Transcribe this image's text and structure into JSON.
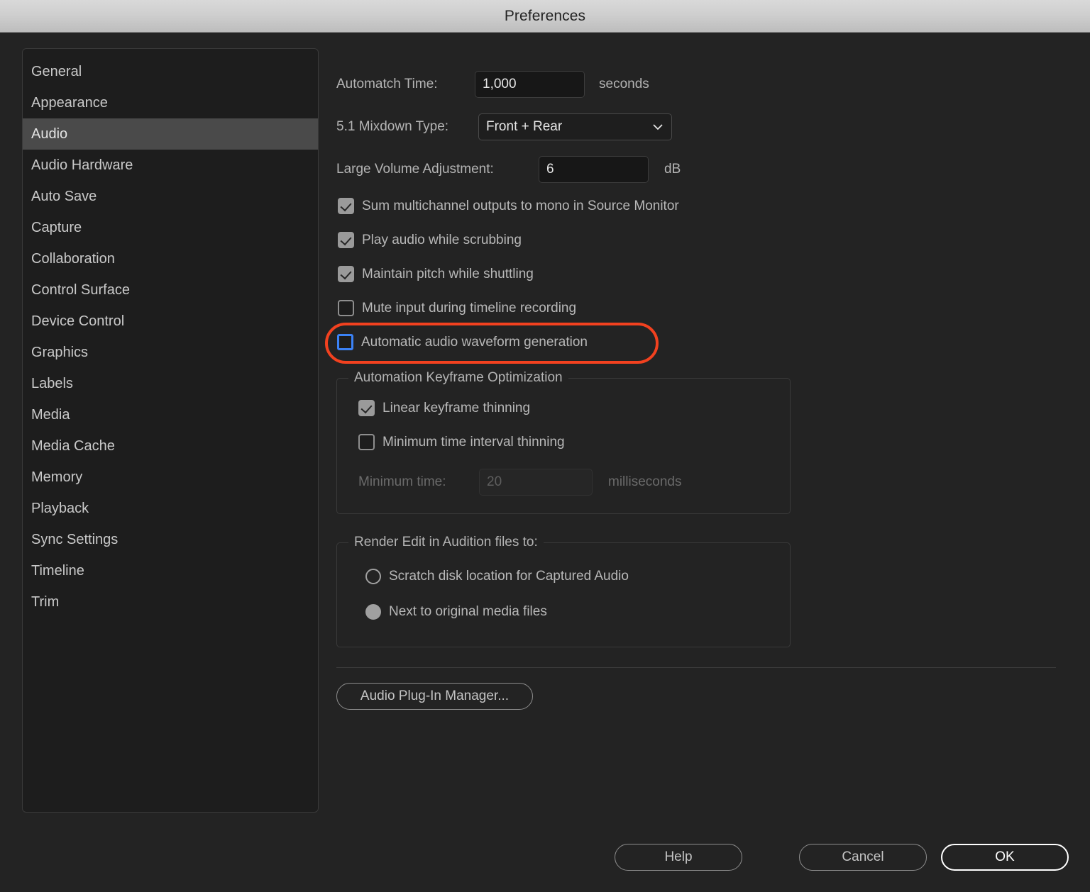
{
  "window": {
    "title": "Preferences"
  },
  "sidebar": {
    "items": [
      {
        "label": "General",
        "selected": false
      },
      {
        "label": "Appearance",
        "selected": false
      },
      {
        "label": "Audio",
        "selected": true
      },
      {
        "label": "Audio Hardware",
        "selected": false
      },
      {
        "label": "Auto Save",
        "selected": false
      },
      {
        "label": "Capture",
        "selected": false
      },
      {
        "label": "Collaboration",
        "selected": false
      },
      {
        "label": "Control Surface",
        "selected": false
      },
      {
        "label": "Device Control",
        "selected": false
      },
      {
        "label": "Graphics",
        "selected": false
      },
      {
        "label": "Labels",
        "selected": false
      },
      {
        "label": "Media",
        "selected": false
      },
      {
        "label": "Media Cache",
        "selected": false
      },
      {
        "label": "Memory",
        "selected": false
      },
      {
        "label": "Playback",
        "selected": false
      },
      {
        "label": "Sync Settings",
        "selected": false
      },
      {
        "label": "Timeline",
        "selected": false
      },
      {
        "label": "Trim",
        "selected": false
      }
    ]
  },
  "main": {
    "automatch": {
      "label": "Automatch Time:",
      "value": "1,000",
      "unit": "seconds"
    },
    "mixdown": {
      "label": "5.1 Mixdown Type:",
      "value": "Front + Rear",
      "icon": "chevron-down-icon"
    },
    "large_volume": {
      "label": "Large Volume Adjustment:",
      "value": "6",
      "unit": "dB"
    },
    "checkboxes": [
      {
        "label": "Sum multichannel outputs to mono in Source Monitor",
        "checked": true,
        "focused": false
      },
      {
        "label": "Play audio while scrubbing",
        "checked": true,
        "focused": false
      },
      {
        "label": "Maintain pitch while shuttling",
        "checked": true,
        "focused": false
      },
      {
        "label": "Mute input during timeline recording",
        "checked": false,
        "focused": false
      },
      {
        "label": "Automatic audio waveform generation",
        "checked": false,
        "focused": true
      }
    ],
    "keyframe_group": {
      "legend": "Automation Keyframe Optimization",
      "checkboxes": [
        {
          "label": "Linear keyframe thinning",
          "checked": true
        },
        {
          "label": "Minimum time interval thinning",
          "checked": false
        }
      ],
      "minimum_time": {
        "label": "Minimum time:",
        "value": "20",
        "unit": "milliseconds",
        "disabled": true
      }
    },
    "render_group": {
      "legend": "Render Edit in Audition files to:",
      "radios": [
        {
          "label": "Scratch disk location for Captured Audio",
          "selected": false
        },
        {
          "label": "Next to original media files",
          "selected": true
        }
      ]
    },
    "plugin_button": "Audio Plug-In Manager..."
  },
  "footer": {
    "help": "Help",
    "cancel": "Cancel",
    "ok": "OK"
  },
  "colors": {
    "accent_focus": "#3b82f6",
    "annotation": "#f2411f",
    "selected_row": "#4a4a4a",
    "dialog_bg": "#232323"
  }
}
